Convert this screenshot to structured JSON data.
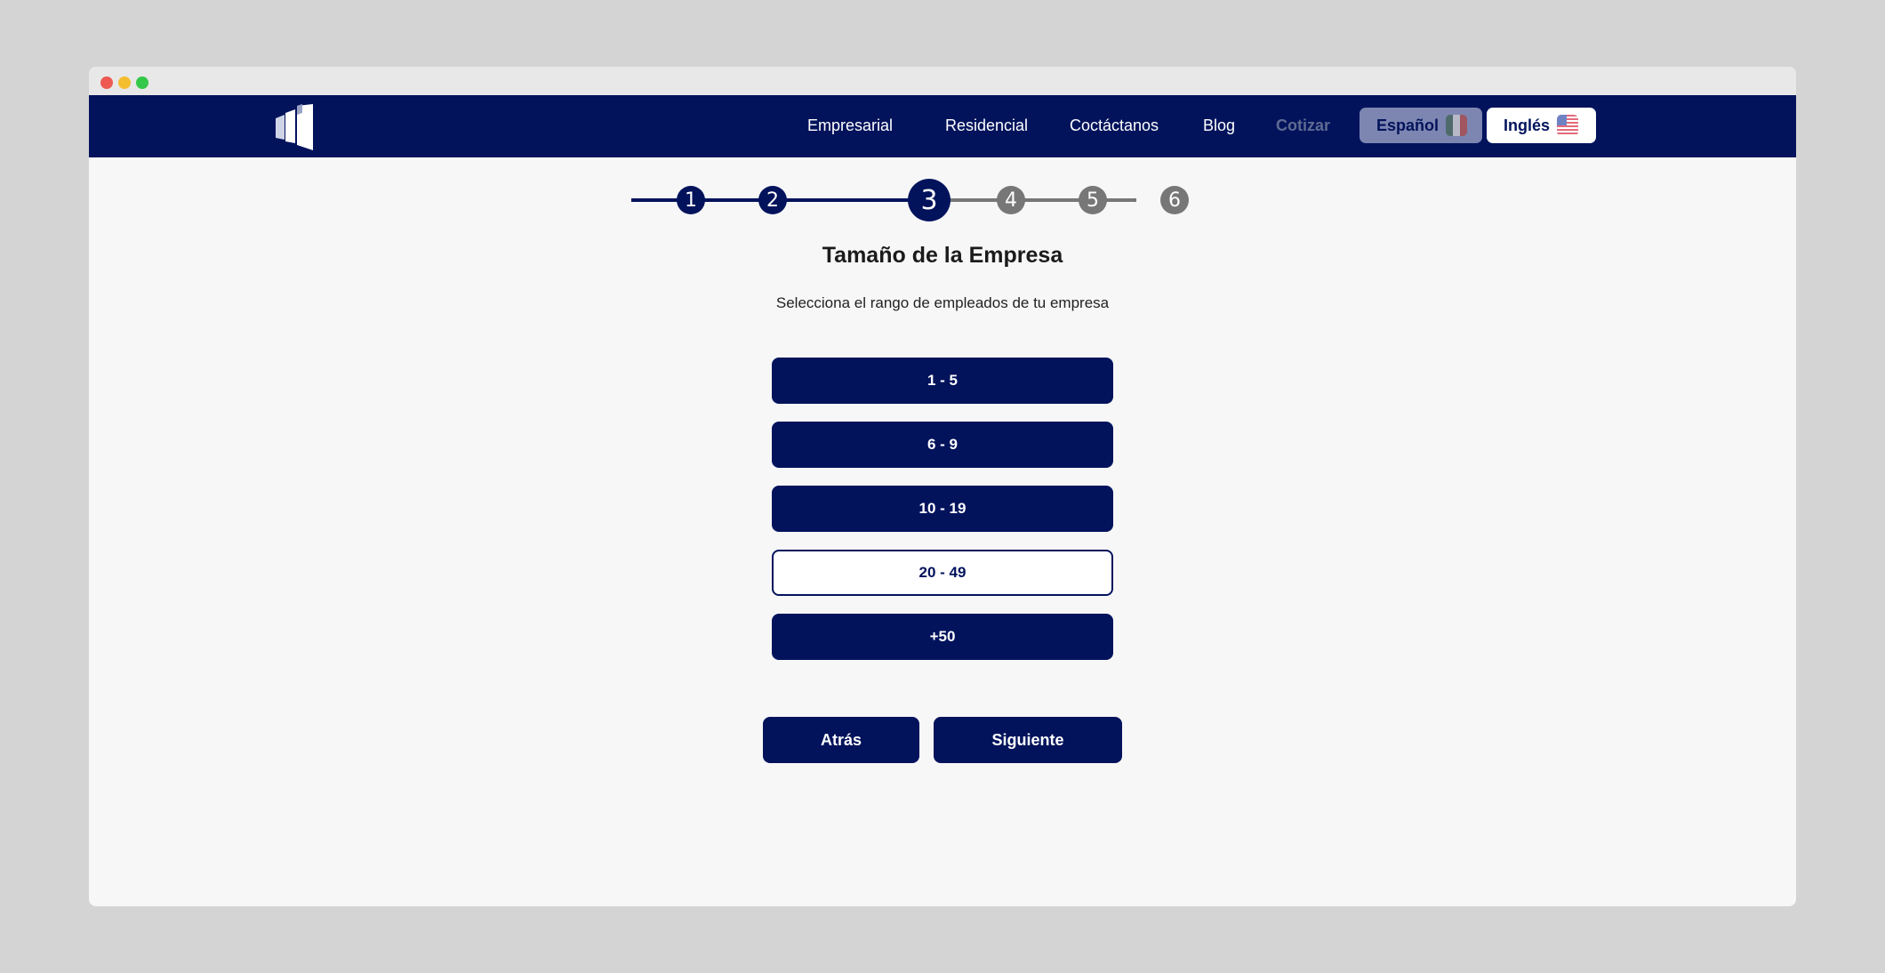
{
  "nav": {
    "links": [
      "Empresarial",
      "Residencial",
      "Coctáctanos",
      "Blog",
      "Cotizar"
    ],
    "languages": [
      {
        "label": "Español",
        "flag": "mexico-flag-icon"
      },
      {
        "label": "Inglés",
        "flag": "us-flag-icon"
      }
    ]
  },
  "stepper": {
    "steps": [
      "1",
      "2",
      "3",
      "4",
      "5",
      "6"
    ],
    "current_step": 3,
    "active_color": "#02135c",
    "inactive_color": "#777777"
  },
  "page": {
    "title": "Tamaño de la Empresa",
    "subtitle": "Selecciona el rango de empleados de tu empresa"
  },
  "options": {
    "items": [
      "1 - 5",
      "6 - 9",
      "10 - 19",
      "20 - 49",
      "+50"
    ],
    "selected": "20 - 49"
  },
  "actions": {
    "back_label": "Atrás",
    "next_label": "Siguiente"
  },
  "colors": {
    "brand": "#02135c",
    "background": "#f7f7f8"
  }
}
